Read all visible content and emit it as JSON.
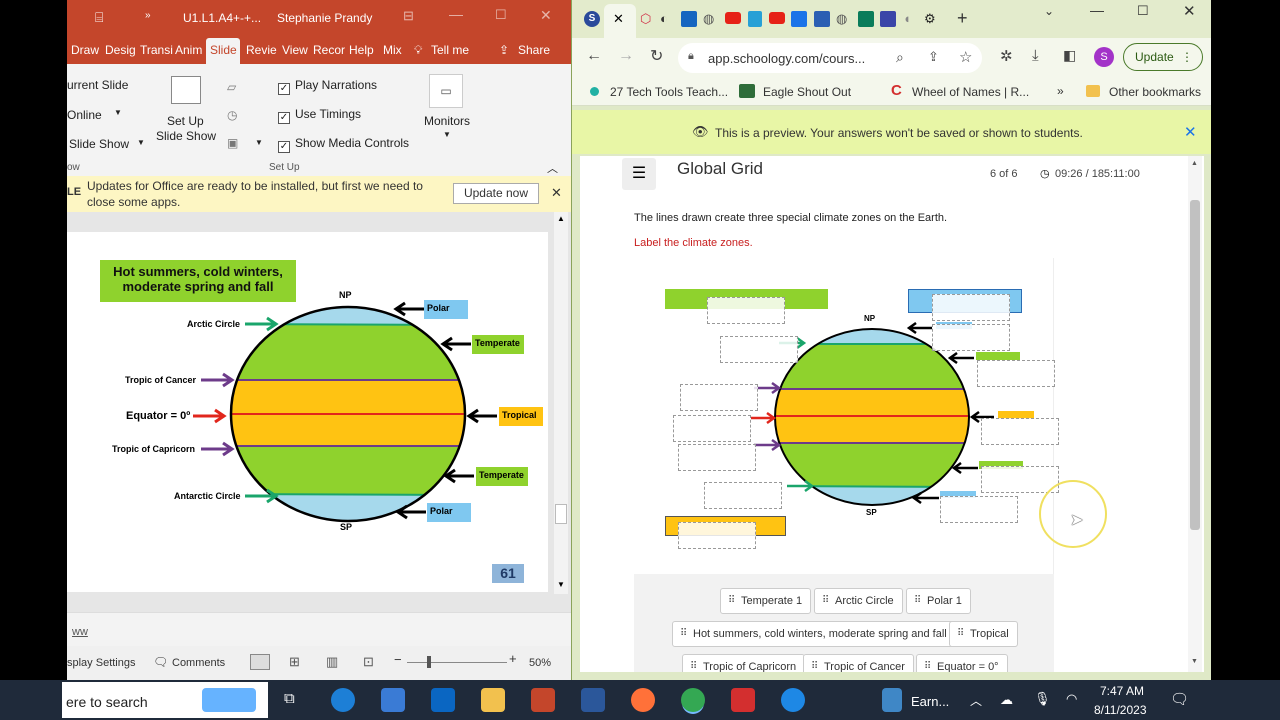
{
  "ppt": {
    "title_file": "U1.L1.A4+-+...",
    "title_user": "Stephanie Prandy",
    "tabs": [
      "Draw",
      "Desig",
      "Transi",
      "Anim",
      "Slide",
      "Revie",
      "View",
      "Recor",
      "Help",
      "Mix"
    ],
    "tell_me": "Tell me",
    "share": "Share",
    "ribbon": {
      "from_current": "urrent Slide",
      "online": "Online",
      "slide_show": "Slide Show",
      "ow": "ow",
      "setup_line1": "Set Up",
      "setup_line2": "Slide Show",
      "play_narrations": "Play Narrations",
      "use_timings": "Use Timings",
      "show_media_controls": "Show Media Controls",
      "monitors": "Monitors",
      "group_setup": "Set Up"
    },
    "message": {
      "prefix": "LE",
      "text_line1": "Updates for Office are ready to be installed, but first we need to",
      "text_line2": "close some apps.",
      "button": "Update now"
    },
    "slide": {
      "callout_line1": "Hot summers, cold winters,",
      "callout_line2": "moderate spring and fall",
      "np": "NP",
      "sp": "SP",
      "left_labels": [
        "Arctic Circle",
        "Tropic of Cancer",
        "Equator = 0º",
        "Tropic of Capricorn",
        "Antarctic Circle"
      ],
      "right_labels": [
        "Polar",
        "Temperate",
        "Tropical",
        "Temperate",
        "Polar"
      ],
      "page_number": "61"
    },
    "notes": "ww",
    "status": {
      "display_settings": "splay Settings",
      "comments": "Comments",
      "zoom": "50%"
    }
  },
  "chrome": {
    "url": "app.schoology.com/cours...",
    "update": "Update",
    "profile": "S",
    "bookmarks": [
      "27 Tech Tools Teach...",
      "Eagle Shout Out",
      "Wheel of Names | R..."
    ],
    "other_bookmarks": "Other bookmarks",
    "preview_text": "This is a preview. Your answers won't be saved or shown to students.",
    "page": {
      "title": "Global Grid",
      "progress": "6 of 6",
      "timer": "09:26 / 185:11:00",
      "prompt": "The lines drawn create three special climate zones on the Earth.",
      "instruction": "Label the climate zones.",
      "np": "NP",
      "sp": "SP",
      "chips": [
        "Temperate 1",
        "Arctic Circle",
        "Polar 1",
        "Hot summers, cold winters, moderate spring and fall",
        "Tropical",
        "Tropic of Capricorn",
        "Tropic of Cancer",
        "Equator = 0°"
      ]
    }
  },
  "taskbar": {
    "search": "ere to search",
    "app_label": "Earn...",
    "time": "7:47 AM",
    "date": "8/11/2023"
  },
  "colors": {
    "ppt_red": "#c4462b",
    "lime": "#8fd22d",
    "polar_blue": "#7fc8f0",
    "tropical_orange": "#ffc312",
    "preview_lime": "#e8f6a6"
  }
}
